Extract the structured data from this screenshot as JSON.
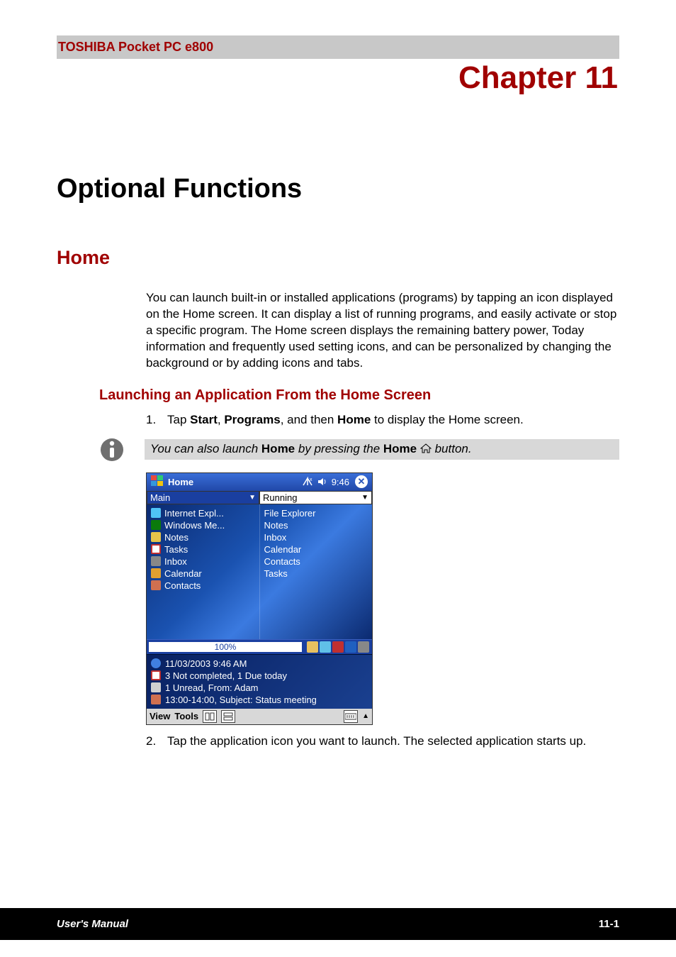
{
  "header": {
    "product": "TOSHIBA Pocket PC e800",
    "chapter": "Chapter 11"
  },
  "section": {
    "title": "Optional Functions",
    "home": {
      "heading": "Home",
      "intro": "You can launch built-in or installed applications (programs) by tapping an icon displayed on the Home screen. It can display a list of running programs, and easily activate or stop a specific program. The Home screen displays the remaining battery power, Today information and frequently used setting icons, and can be personalized by changing the background or by adding icons and tabs.",
      "launch_heading": "Launching an Application From the Home Screen",
      "steps": {
        "s1_num": "1.",
        "s1_text_before_start": "Tap ",
        "s1_start": "Start",
        "s1_sep1": ", ",
        "s1_programs": "Programs",
        "s1_sep2": ", and then ",
        "s1_home": "Home",
        "s1_after": " to display the Home screen.",
        "s2_num": "2.",
        "s2_text": "Tap the application icon you want to launch. The selected application starts up."
      },
      "note_before": "You can also launch ",
      "note_home1": "Home",
      "note_mid": " by pressing the ",
      "note_home2": "Home",
      "note_after": " button."
    }
  },
  "device": {
    "title": "Home",
    "time": "9:46",
    "dd_left": "Main",
    "dd_right": "Running",
    "left_items": [
      "Internet Expl...",
      "Windows Me...",
      "Notes",
      "Tasks",
      "Inbox",
      "Calendar",
      "Contacts"
    ],
    "right_items": [
      "File Explorer",
      "Notes",
      "Inbox",
      "Calendar",
      "Contacts",
      "Tasks"
    ],
    "battery": "100%",
    "today": {
      "datetime": "11/03/2003 9:46 AM",
      "tasks": "3 Not completed, 1 Due today",
      "mail": "1 Unread, From: Adam",
      "cal": "13:00-14:00, Subject: Status meeting"
    },
    "view": "View",
    "tools": "Tools"
  },
  "footer": {
    "left": "User's Manual",
    "right": "11-1"
  }
}
